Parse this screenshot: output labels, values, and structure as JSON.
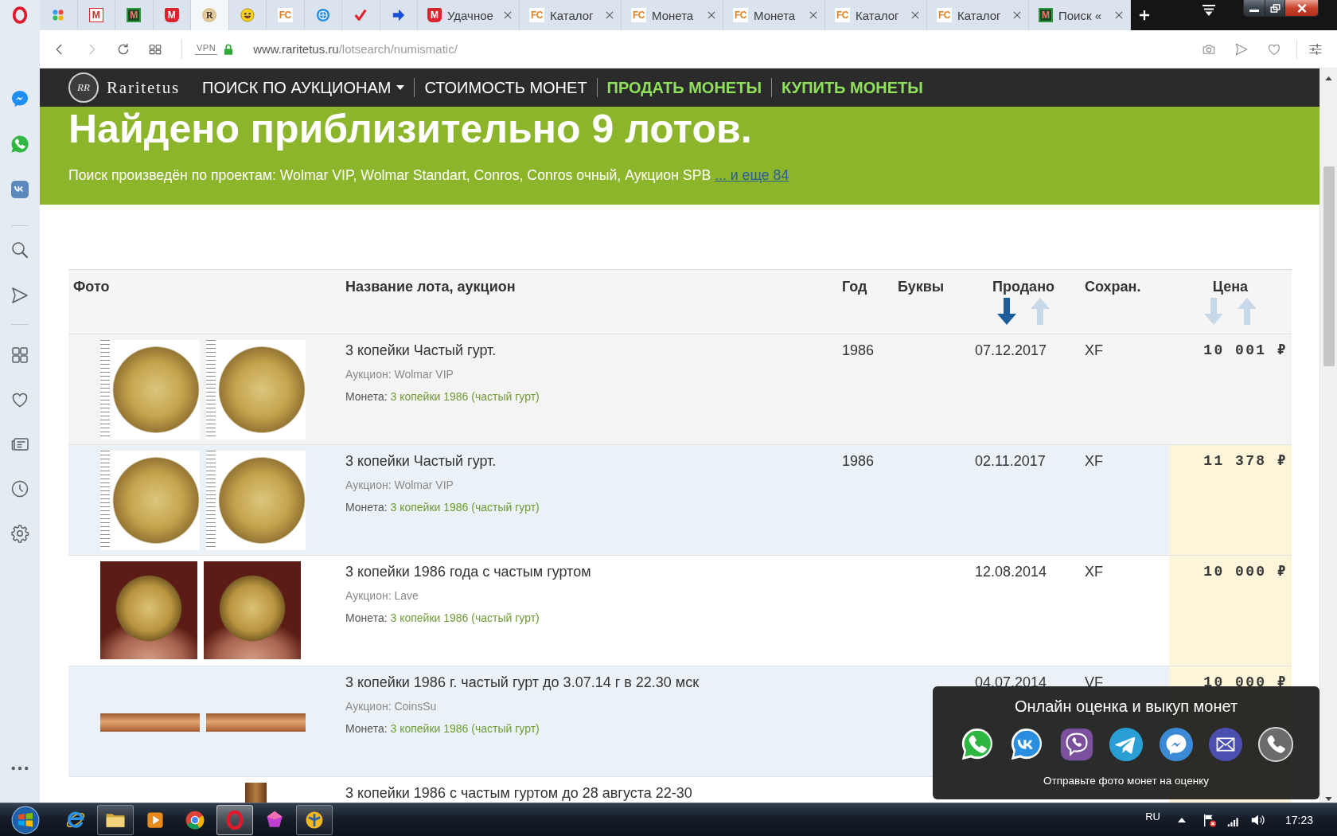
{
  "browser": {
    "tabs": [
      {
        "kind": "dial",
        "selected": false
      },
      {
        "kind": "m-plain",
        "favicon_text": "M",
        "selected": false
      },
      {
        "kind": "m-square",
        "favicon_text": "M",
        "selected": false
      },
      {
        "kind": "m-bag",
        "favicon_text": "M",
        "selected": false
      },
      {
        "kind": "coin",
        "favicon_text": "R",
        "selected": true
      },
      {
        "kind": "smiley",
        "selected": false
      },
      {
        "kind": "fc",
        "favicon_text": "FC",
        "selected": false
      },
      {
        "kind": "globe",
        "selected": false
      },
      {
        "kind": "tick",
        "selected": false
      },
      {
        "kind": "arrow",
        "selected": false
      },
      {
        "kind": "m-bag",
        "favicon_text": "M",
        "title": "Удачное",
        "selected": false
      },
      {
        "kind": "fc",
        "favicon_text": "FC",
        "title": "Каталог",
        "selected": false
      },
      {
        "kind": "fc",
        "favicon_text": "FC",
        "title": "Монета",
        "selected": false
      },
      {
        "kind": "fc",
        "favicon_text": "FC",
        "title": "Монета",
        "selected": false
      },
      {
        "kind": "fc",
        "favicon_text": "FC",
        "title": "Каталог",
        "selected": false
      },
      {
        "kind": "fc",
        "favicon_text": "FC",
        "title": "Каталог",
        "selected": false
      },
      {
        "kind": "m-square",
        "favicon_text": "M",
        "title": "Поиск «",
        "selected": false
      }
    ],
    "address": {
      "vpn": "VPN",
      "host": "www.raritetus.ru",
      "path": "/lotsearch/numismatic/"
    }
  },
  "site": {
    "logo": {
      "monogram": "RR",
      "name": "Raritetus"
    },
    "nav": [
      {
        "label": "ПОИСК ПО АУКЦИОНАМ",
        "dropdown": true,
        "highlighted": false
      },
      {
        "label": "СТОИМОСТЬ МОНЕТ",
        "dropdown": false,
        "highlighted": false
      },
      {
        "label": "ПРОДАТЬ МОНЕТЫ",
        "dropdown": false,
        "highlighted": true
      },
      {
        "label": "КУПИТЬ МОНЕТЫ",
        "dropdown": false,
        "highlighted": true
      }
    ],
    "banner": {
      "title": "Найдено приблизительно 9 лотов.",
      "subtitle": "Поиск произведён по проектам: Wolmar VIP, Wolmar Standart, Conros, Conros очный, Аукцион SPB",
      "more_link": "... и еще 84"
    }
  },
  "table": {
    "columns": [
      {
        "label": "Фото"
      },
      {
        "label": "Название лота, аукцион"
      },
      {
        "label": "Год"
      },
      {
        "label": "Буквы"
      },
      {
        "label": "Продано",
        "sort_arrows": [
          {
            "kind": "down",
            "selected": true
          },
          {
            "kind": "up",
            "selected": false
          }
        ]
      },
      {
        "label": "Сохран."
      },
      {
        "label": "Цена",
        "sort_arrows": [
          {
            "kind": "down",
            "selected": false
          },
          {
            "kind": "up",
            "selected": false
          }
        ]
      }
    ],
    "rows": [
      {
        "hovered": true,
        "photos": [
          {
            "kind": "scan"
          },
          {
            "kind": "scan"
          }
        ],
        "title": "3 копейки Частый гурт.",
        "auction": "Аукцион: Wolmar VIP",
        "coin_label": "Монета:",
        "coin": "3 копейки 1986 (частый гурт)",
        "year": "1986",
        "sold": "07.12.2017",
        "grade": "XF",
        "price": "10 001 ₽"
      },
      {
        "hovered": false,
        "photos": [
          {
            "kind": "scan"
          },
          {
            "kind": "scan"
          }
        ],
        "title": "3 копейки Частый гурт.",
        "auction": "Аукцион: Wolmar VIP",
        "coin_label": "Монета:",
        "coin": "3 копейки 1986 (частый гурт)",
        "year": "1986",
        "sold": "02.11.2017",
        "grade": "XF",
        "price": "11 378 ₽"
      },
      {
        "hovered": false,
        "photos": [
          {
            "kind": "hand"
          },
          {
            "kind": "hand"
          }
        ],
        "title": "3 копейки 1986 года с частым гуртом",
        "auction": "Аукцион: Lave",
        "coin_label": "Монета:",
        "coin": "3 копейки 1986 (частый гурт)",
        "sold": "12.08.2014",
        "grade": "XF",
        "price": "10 000 ₽"
      },
      {
        "hovered": false,
        "photos": [
          {
            "kind": "edge"
          },
          {
            "kind": "edge"
          }
        ],
        "title": "3 копейки 1986 г. частый гурт до 3.07.14 г в 22.30 мск",
        "auction": "Аукцион: CoinsSu",
        "coin_label": "Монета:",
        "coin": "3 копейки 1986 (частый гурт)",
        "sold": "04.07.2014",
        "grade": "VF",
        "price": "10 000 ₽"
      },
      {
        "hovered": false,
        "photos": [
          {
            "kind": "partial"
          }
        ],
        "title": "3 копейки 1986 с частым гуртом до 28 августа 22-30"
      }
    ]
  },
  "popup": {
    "title": "Онлайн оценка и выкуп монет",
    "footer": "Отправьте фото монет на оценку"
  },
  "taskbar": {
    "apps": [
      {
        "kind": "ie",
        "running": false,
        "selected": false
      },
      {
        "kind": "folder",
        "running": true,
        "selected": false
      },
      {
        "kind": "media",
        "running": false,
        "selected": false
      },
      {
        "kind": "chrome",
        "running": false,
        "selected": false
      },
      {
        "kind": "opera",
        "running": true,
        "selected": true
      },
      {
        "kind": "gem",
        "running": false,
        "selected": false
      },
      {
        "kind": "badge",
        "running": true,
        "selected": false
      }
    ],
    "language": "RU",
    "clock": "17:23"
  }
}
